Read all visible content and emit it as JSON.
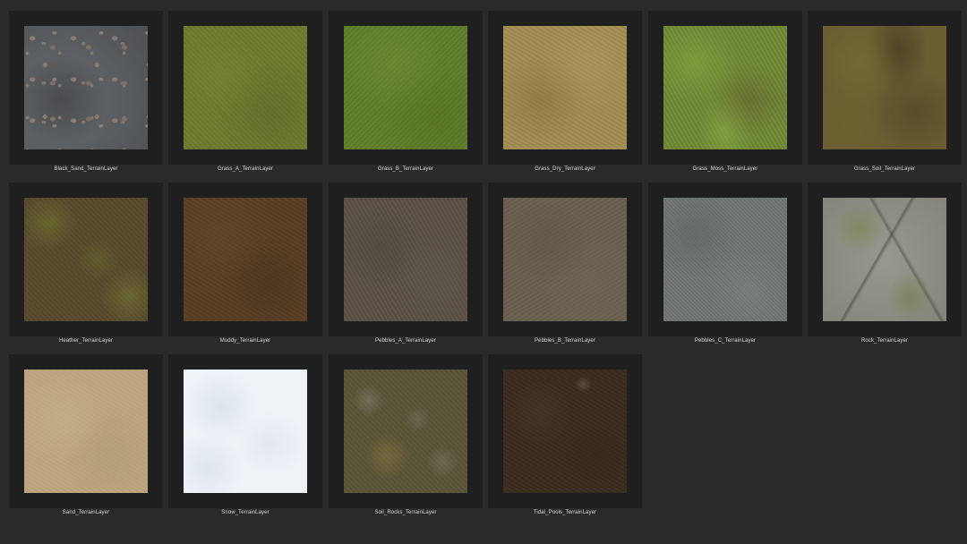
{
  "gallery": {
    "items": [
      {
        "label": "Black_Sand_TerrainLayer",
        "texture": "black-sand"
      },
      {
        "label": "Grass_A_TerrainLayer",
        "texture": "grass-a"
      },
      {
        "label": "Grass_B_TerrainLayer",
        "texture": "grass-b"
      },
      {
        "label": "Grass_Dry_TerrainLayer",
        "texture": "grass-dry"
      },
      {
        "label": "Grass_Moss_TerrainLayer",
        "texture": "grass-moss"
      },
      {
        "label": "Grass_Soil_TerrainLayer",
        "texture": "grass-soil"
      },
      {
        "label": "Heather_TerrainLayer",
        "texture": "heather"
      },
      {
        "label": "Muddy_TerrainLayer",
        "texture": "muddy"
      },
      {
        "label": "Pebbles_A_TerrainLayer",
        "texture": "pebbles-a"
      },
      {
        "label": "Pebbles_B_TerrainLayer",
        "texture": "pebbles-b"
      },
      {
        "label": "Pebbles_C_TerrainLayer",
        "texture": "pebbles-c"
      },
      {
        "label": "Rock_TerrainLayer",
        "texture": "rock"
      },
      {
        "label": "Sand_TerrainLayer",
        "texture": "sand"
      },
      {
        "label": "Snow_TerrainLayer",
        "texture": "snow"
      },
      {
        "label": "Soil_Rocks_TerrainLayer",
        "texture": "soil-rocks"
      },
      {
        "label": "Tidal_Pools_TerrainLayer",
        "texture": "tidal-pools"
      }
    ]
  },
  "colors": {
    "background": "#2a2a2a",
    "tile_background": "#1f1f1f",
    "label_text": "#d8d8d8"
  }
}
